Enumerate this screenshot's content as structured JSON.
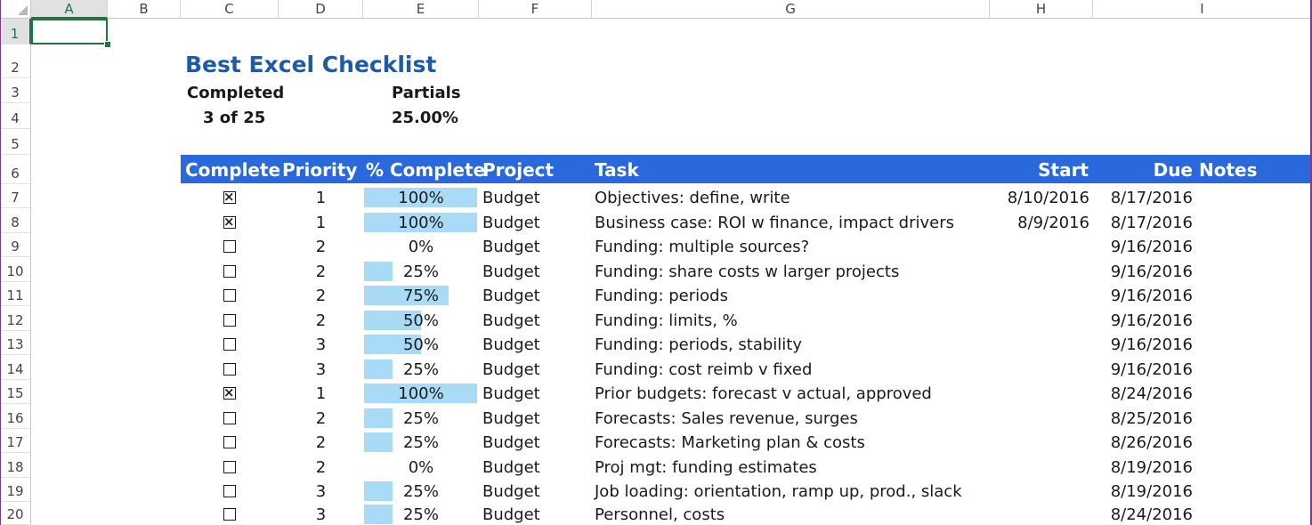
{
  "sheet": {
    "columns": [
      "A",
      "B",
      "C",
      "D",
      "E",
      "F",
      "G",
      "H",
      "I"
    ],
    "selected_column": "A",
    "selected_row": "1",
    "rows": [
      "1",
      "2",
      "3",
      "4",
      "5",
      "6",
      "7",
      "8",
      "9",
      "10",
      "11",
      "12",
      "13",
      "14",
      "15",
      "16",
      "17",
      "18",
      "19",
      "20"
    ],
    "title": "Best Excel Checklist",
    "completed_label": "Completed",
    "completed_value": "3 of 25",
    "partials_label": "Partials",
    "partials_value": "25.00%",
    "headers": {
      "complete": "Complete",
      "priority": "Priority",
      "pct_complete": "% Complete",
      "project": "Project",
      "task": "Task",
      "start": "Start",
      "due": "Due",
      "notes": "Notes"
    },
    "colors": {
      "header_band": "#2969dc",
      "progress_bar": "#a9dbf6",
      "title": "#1f5aa6",
      "selection": "#217346"
    },
    "tasks": [
      {
        "complete": true,
        "priority": "1",
        "pct": "100%",
        "pct_value": 1.0,
        "project": "Budget",
        "task": "Objectives: define, write",
        "start": "8/10/2016",
        "due": "8/17/2016"
      },
      {
        "complete": true,
        "priority": "1",
        "pct": "100%",
        "pct_value": 1.0,
        "project": "Budget",
        "task": "Business case: ROI w finance, impact drivers",
        "start": "8/9/2016",
        "due": "8/17/2016"
      },
      {
        "complete": false,
        "priority": "2",
        "pct": "0%",
        "pct_value": 0.0,
        "project": "Budget",
        "task": "Funding: multiple sources?",
        "start": "",
        "due": "9/16/2016"
      },
      {
        "complete": false,
        "priority": "2",
        "pct": "25%",
        "pct_value": 0.25,
        "project": "Budget",
        "task": "Funding: share costs w larger projects",
        "start": "",
        "due": "9/16/2016"
      },
      {
        "complete": false,
        "priority": "2",
        "pct": "75%",
        "pct_value": 0.75,
        "project": "Budget",
        "task": "Funding: periods",
        "start": "",
        "due": "9/16/2016"
      },
      {
        "complete": false,
        "priority": "2",
        "pct": "50%",
        "pct_value": 0.5,
        "project": "Budget",
        "task": "Funding: limits, %",
        "start": "",
        "due": "9/16/2016"
      },
      {
        "complete": false,
        "priority": "3",
        "pct": "50%",
        "pct_value": 0.5,
        "project": "Budget",
        "task": "Funding: periods, stability",
        "start": "",
        "due": "9/16/2016"
      },
      {
        "complete": false,
        "priority": "3",
        "pct": "25%",
        "pct_value": 0.25,
        "project": "Budget",
        "task": "Funding: cost reimb v fixed",
        "start": "",
        "due": "9/16/2016"
      },
      {
        "complete": true,
        "priority": "1",
        "pct": "100%",
        "pct_value": 1.0,
        "project": "Budget",
        "task": "Prior budgets: forecast v actual, approved",
        "start": "",
        "due": "8/24/2016"
      },
      {
        "complete": false,
        "priority": "2",
        "pct": "25%",
        "pct_value": 0.25,
        "project": "Budget",
        "task": "Forecasts: Sales revenue, surges",
        "start": "",
        "due": "8/25/2016"
      },
      {
        "complete": false,
        "priority": "2",
        "pct": "25%",
        "pct_value": 0.25,
        "project": "Budget",
        "task": "Forecasts: Marketing plan & costs",
        "start": "",
        "due": "8/26/2016"
      },
      {
        "complete": false,
        "priority": "2",
        "pct": "0%",
        "pct_value": 0.0,
        "project": "Budget",
        "task": "Proj mgt: funding estimates",
        "start": "",
        "due": "8/19/2016"
      },
      {
        "complete": false,
        "priority": "3",
        "pct": "25%",
        "pct_value": 0.25,
        "project": "Budget",
        "task": "Job loading: orientation, ramp up, prod., slack",
        "start": "",
        "due": "8/19/2016"
      },
      {
        "complete": false,
        "priority": "3",
        "pct": "25%",
        "pct_value": 0.25,
        "project": "Budget",
        "task": "Personnel, costs",
        "start": "",
        "due": "8/24/2016"
      }
    ]
  }
}
